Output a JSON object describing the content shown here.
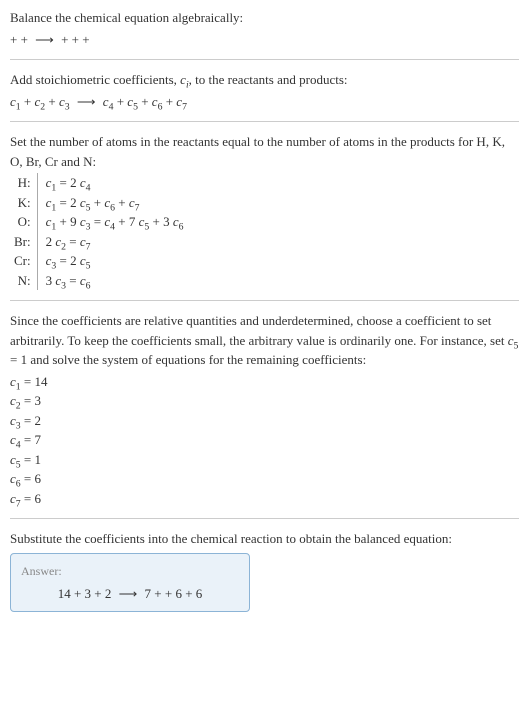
{
  "intro": {
    "line1": "Balance the chemical equation algebraically:",
    "line2_pre": " +  + ",
    "line2_arrow": "⟶",
    "line2_post": " +  +  + "
  },
  "stoich": {
    "line1_pre": "Add stoichiometric coefficients, ",
    "line1_ci_c": "c",
    "line1_ci_i": "i",
    "line1_post": ", to the reactants and products:",
    "eq_arrow": "⟶",
    "c1": "c",
    "n1": "1",
    "c2": "c",
    "n2": "2",
    "c3": "c",
    "n3": "3",
    "c4": "c",
    "n4": "4",
    "c5": "c",
    "n5": "5",
    "c6": "c",
    "n6": "6",
    "c7": "c",
    "n7": "7",
    "plus": " + "
  },
  "atoms": {
    "intro1": "Set the number of atoms in the reactants equal to the number of atoms in the products for H, K, O, Br, Cr and N:",
    "rows": {
      "H": {
        "label": "H:",
        "c_a": "c",
        "n_a": "1",
        "mid": " = 2 ",
        "c_b": "c",
        "n_b": "4"
      },
      "K": {
        "label": "K:",
        "c_a": "c",
        "n_a": "1",
        "mid": " = 2 ",
        "c_b": "c",
        "n_b": "5",
        "plus1": " + ",
        "c_c": "c",
        "n_c": "6",
        "plus2": " + ",
        "c_d": "c",
        "n_d": "7"
      },
      "O": {
        "label": "O:",
        "c_a": "c",
        "n_a": "1",
        "plus0": " + 9 ",
        "c_b": "c",
        "n_b": "3",
        "mid": " = ",
        "c_c": "c",
        "n_c": "4",
        "plus1": " + 7 ",
        "c_d": "c",
        "n_d": "5",
        "plus2": " + 3 ",
        "c_e": "c",
        "n_e": "6"
      },
      "Br": {
        "label": "Br:",
        "pre": "2 ",
        "c_a": "c",
        "n_a": "2",
        "mid": " = ",
        "c_b": "c",
        "n_b": "7"
      },
      "Cr": {
        "label": "Cr:",
        "c_a": "c",
        "n_a": "3",
        "mid": " = 2 ",
        "c_b": "c",
        "n_b": "5"
      },
      "N": {
        "label": "N:",
        "pre": "3 ",
        "c_a": "c",
        "n_a": "3",
        "mid": " = ",
        "c_b": "c",
        "n_b": "6"
      }
    }
  },
  "solve": {
    "para_pre": "Since the coefficients are relative quantities and underdetermined, choose a coefficient to set arbitrarily. To keep the coefficients small, the arbitrary value is ordinarily one. For instance, set ",
    "c5_c": "c",
    "c5_n": "5",
    "para_post": " = 1 and solve the system of equations for the remaining coefficients:",
    "coeffs": {
      "c1": {
        "c": "c",
        "n": "1",
        "val": " = 14"
      },
      "c2": {
        "c": "c",
        "n": "2",
        "val": " = 3"
      },
      "c3": {
        "c": "c",
        "n": "3",
        "val": " = 2"
      },
      "c4": {
        "c": "c",
        "n": "4",
        "val": " = 7"
      },
      "c5": {
        "c": "c",
        "n": "5",
        "val": " = 1"
      },
      "c6": {
        "c": "c",
        "n": "6",
        "val": " = 6"
      },
      "c7": {
        "c": "c",
        "n": "7",
        "val": " = 6"
      }
    }
  },
  "substitute": {
    "para": "Substitute the coefficients into the chemical reaction to obtain the balanced equation:"
  },
  "answer": {
    "label": "Answer:",
    "eq_pre": "14  + 3  + 2 ",
    "arrow": "⟶",
    "eq_post": " 7  +  + 6  + 6"
  }
}
